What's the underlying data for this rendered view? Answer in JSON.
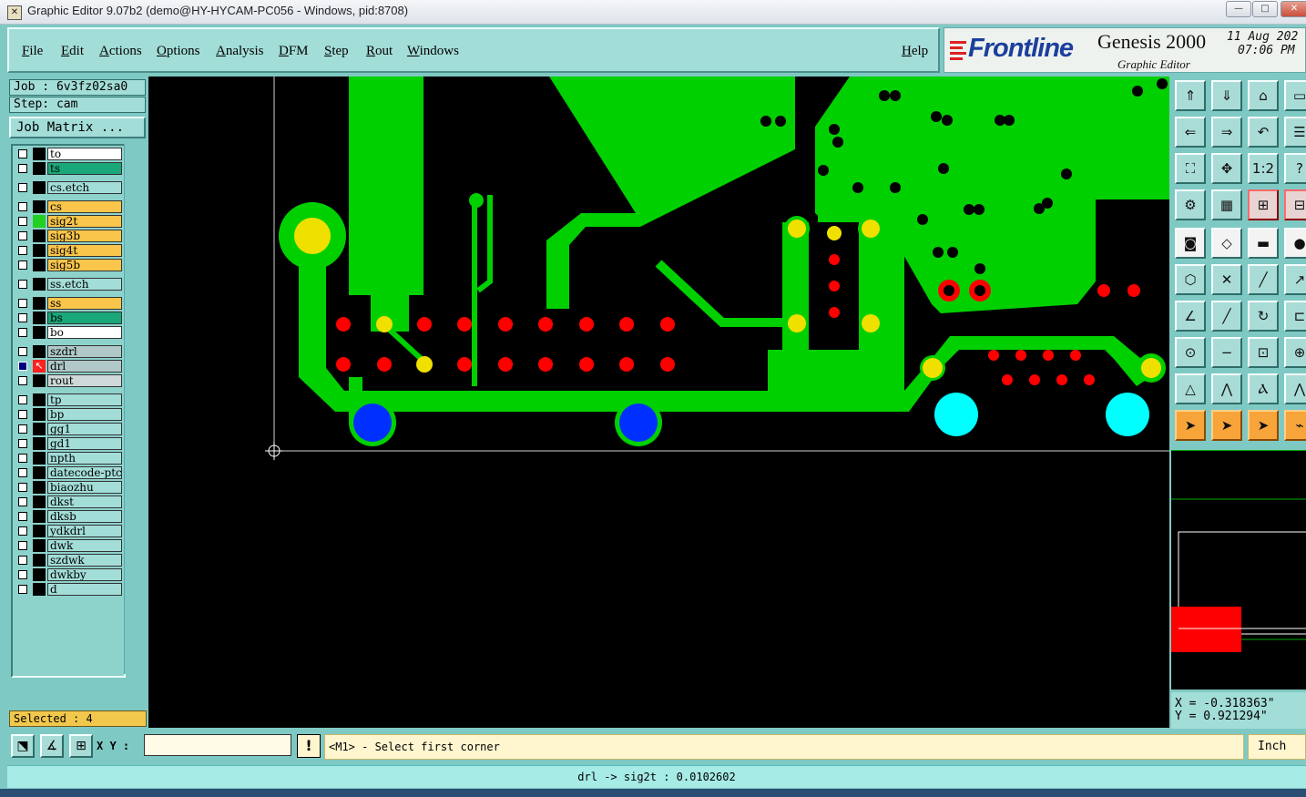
{
  "window": {
    "title": "Graphic Editor 9.07b2 (demo@HY-HYCAM-PC056 - Windows, pid:8708)",
    "min_glyph": "—",
    "max_glyph": "□",
    "close_glyph": "✕"
  },
  "menu": [
    "File",
    "Edit",
    "Actions",
    "Options",
    "Analysis",
    "DFM",
    "Step",
    "Rout",
    "Windows"
  ],
  "help": "Help",
  "branding": {
    "logo": "Frontline",
    "product": "Genesis 2000",
    "subtitle": "Graphic Editor",
    "date": "11 Aug 202",
    "time": "07:06 PM",
    "logo_color": "#1b3f9c"
  },
  "job": "Job : 6v3fz02sa0",
  "step": "Step: cam",
  "job_matrix_label": "Job Matrix ...",
  "layers": [
    {
      "name": "to",
      "color": "#ffffff",
      "gap_before": false
    },
    {
      "name": "ts",
      "color": "#1aa77a",
      "gap_before": false
    },
    {
      "name": "cs.etch",
      "color": "#a3ddd8",
      "gap_before": true
    },
    {
      "name": "cs",
      "color": "#f9c54a",
      "gap_before": true
    },
    {
      "name": "sig2t",
      "color": "#f9c54a",
      "gap_before": false,
      "active_color": "#22d022"
    },
    {
      "name": "sig3b",
      "color": "#f9c54a",
      "gap_before": false
    },
    {
      "name": "sig4t",
      "color": "#f9c54a",
      "gap_before": false
    },
    {
      "name": "sig5b",
      "color": "#f9c54a",
      "gap_before": false
    },
    {
      "name": "ss.etch",
      "color": "#a3ddd8",
      "gap_before": true
    },
    {
      "name": "ss",
      "color": "#f9c54a",
      "gap_before": true
    },
    {
      "name": "bs",
      "color": "#1aa77a",
      "gap_before": false
    },
    {
      "name": "bo",
      "color": "#ffffff",
      "gap_before": false
    },
    {
      "name": "szdrl",
      "color": "#b0c8c8",
      "gap_before": true
    },
    {
      "name": "drl",
      "color": "#b0c8c8",
      "gap_before": false,
      "work_layer": true
    },
    {
      "name": "rout",
      "color": "#cfd8d8",
      "gap_before": false
    },
    {
      "name": "tp",
      "color": "#a3ddd8",
      "gap_before": true
    },
    {
      "name": "bp",
      "color": "#a3ddd8",
      "gap_before": false
    },
    {
      "name": "gg1",
      "color": "#a3ddd8",
      "gap_before": false
    },
    {
      "name": "gd1",
      "color": "#a3ddd8",
      "gap_before": false
    },
    {
      "name": "npth",
      "color": "#a3ddd8",
      "gap_before": false
    },
    {
      "name": "datecode-ptc",
      "color": "#a3ddd8",
      "gap_before": false
    },
    {
      "name": "biaozhu",
      "color": "#a3ddd8",
      "gap_before": false
    },
    {
      "name": "dkst",
      "color": "#a3ddd8",
      "gap_before": false
    },
    {
      "name": "dksb",
      "color": "#a3ddd8",
      "gap_before": false
    },
    {
      "name": "ydkdrl",
      "color": "#a3ddd8",
      "gap_before": false
    },
    {
      "name": "dwk",
      "color": "#a3ddd8",
      "gap_before": false
    },
    {
      "name": "szdwk",
      "color": "#a3ddd8",
      "gap_before": false
    },
    {
      "name": "dwkby",
      "color": "#a3ddd8",
      "gap_before": false
    },
    {
      "name": "d",
      "color": "#a3ddd8",
      "gap_before": false
    }
  ],
  "selected": "Selected : 4",
  "toolbar": [
    {
      "icon": "layer-up-icon",
      "glyph": "⇑",
      "style": ""
    },
    {
      "icon": "layer-down-icon",
      "glyph": "⇓",
      "style": ""
    },
    {
      "icon": "home-icon",
      "glyph": "⌂",
      "style": ""
    },
    {
      "icon": "panel-icon",
      "glyph": "▭",
      "style": ""
    },
    {
      "icon": "arrow-left-icon",
      "glyph": "⇐",
      "style": ""
    },
    {
      "icon": "arrow-right-icon",
      "glyph": "⇒",
      "style": ""
    },
    {
      "icon": "undo-icon",
      "glyph": "↶",
      "style": ""
    },
    {
      "icon": "list-icon",
      "glyph": "☰",
      "style": ""
    },
    {
      "icon": "zoom-fit-icon",
      "glyph": "⛶",
      "style": ""
    },
    {
      "icon": "pan-icon",
      "glyph": "✥",
      "style": ""
    },
    {
      "icon": "scale-1-2-icon",
      "glyph": "1:2",
      "style": ""
    },
    {
      "icon": "query-icon",
      "glyph": "?",
      "style": ""
    },
    {
      "icon": "settings-icon",
      "glyph": "⚙",
      "style": ""
    },
    {
      "icon": "grid-icon",
      "glyph": "▦",
      "style": ""
    },
    {
      "icon": "components-icon",
      "glyph": "⊞",
      "style": "red"
    },
    {
      "icon": "net-icon",
      "glyph": "⊟",
      "style": "red"
    },
    {
      "icon": "snapshot-icon",
      "glyph": "◙",
      "style": "white"
    },
    {
      "icon": "measure-icon",
      "glyph": "◇",
      "style": "white"
    },
    {
      "icon": "ruler-icon",
      "glyph": "▬",
      "style": "white"
    },
    {
      "icon": "pad-icon",
      "glyph": "●",
      "style": "white"
    },
    {
      "icon": "connect-icon",
      "glyph": "⬡",
      "style": ""
    },
    {
      "icon": "cross-icon",
      "glyph": "✕",
      "style": ""
    },
    {
      "icon": "line-icon",
      "glyph": "╱",
      "style": ""
    },
    {
      "icon": "arc-icon",
      "glyph": "↗",
      "style": ""
    },
    {
      "icon": "angle-icon",
      "glyph": "∠",
      "style": ""
    },
    {
      "icon": "slash-icon",
      "glyph": "╱",
      "style": ""
    },
    {
      "icon": "rotate-icon",
      "glyph": "↻",
      "style": ""
    },
    {
      "icon": "bracket-icon",
      "glyph": "⊏",
      "style": ""
    },
    {
      "icon": "node-icon",
      "glyph": "⊙",
      "style": ""
    },
    {
      "icon": "minus-icon",
      "glyph": "−",
      "style": ""
    },
    {
      "icon": "frame-icon",
      "glyph": "⊡",
      "style": ""
    },
    {
      "icon": "group-icon",
      "glyph": "⊕",
      "style": ""
    },
    {
      "icon": "triangle-a-icon",
      "glyph": "△",
      "style": ""
    },
    {
      "icon": "triangle-b-icon",
      "glyph": "⋀",
      "style": ""
    },
    {
      "icon": "triangle-c-icon",
      "glyph": "Ⲁ",
      "style": ""
    },
    {
      "icon": "triangle-d-icon",
      "glyph": "⋀",
      "style": ""
    },
    {
      "icon": "pointer-icon",
      "glyph": "➤",
      "style": "orange"
    },
    {
      "icon": "pointer-select-icon",
      "glyph": "➤",
      "style": "orange"
    },
    {
      "icon": "pointer-move-icon",
      "glyph": "➤",
      "style": "orange"
    },
    {
      "icon": "tool-icon",
      "glyph": "⌁",
      "style": "orange"
    }
  ],
  "coords": {
    "x": "X = -0.318363\"",
    "y": "Y = 0.921294\""
  },
  "xy_label": "X Y :",
  "xy_value": "",
  "prompt": "<M1> - Select first corner",
  "units": "Inch",
  "status": "drl -> sig2t : 0.0102602",
  "colors": {
    "copper": "#00d000",
    "pad": "#f0e000",
    "drill": "#ff0000",
    "via": "#0030ff",
    "npth": "#00ffff",
    "background": "#000000"
  }
}
